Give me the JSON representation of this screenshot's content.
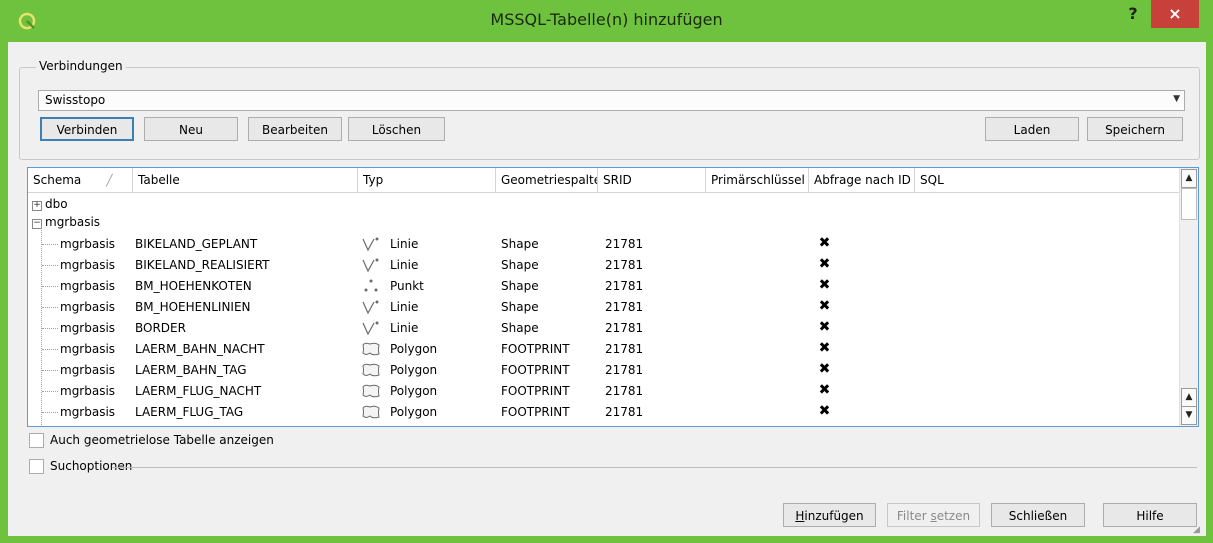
{
  "window": {
    "title": "MSSQL-Tabelle(n) hinzufügen",
    "help": "?",
    "close": "×"
  },
  "connections": {
    "legend": "Verbindungen",
    "selected": "Swisstopo",
    "buttons": {
      "connect": "Verbinden",
      "new": "Neu",
      "edit": "Bearbeiten",
      "delete": "Löschen",
      "load": "Laden",
      "save": "Speichern"
    }
  },
  "table": {
    "columns": [
      "Schema",
      "Tabelle",
      "Typ",
      "Geometriespalte",
      "SRID",
      "Primärschlüssel",
      "Abfrage nach ID",
      "SQL"
    ],
    "groups": [
      {
        "expander": "+",
        "name": "dbo"
      },
      {
        "expander": "−",
        "name": "mgrbasis"
      }
    ],
    "rows": [
      {
        "schema": "mgrbasis",
        "table": "BIKELAND_GEPLANT",
        "type": "Linie",
        "type_icon": "line-icon",
        "geom": "Shape",
        "srid": "21781",
        "select_id": true
      },
      {
        "schema": "mgrbasis",
        "table": "BIKELAND_REALISIERT",
        "type": "Linie",
        "type_icon": "line-icon",
        "geom": "Shape",
        "srid": "21781",
        "select_id": true
      },
      {
        "schema": "mgrbasis",
        "table": "BM_HOEHENKOTEN",
        "type": "Punkt",
        "type_icon": "point-icon",
        "geom": "Shape",
        "srid": "21781",
        "select_id": true
      },
      {
        "schema": "mgrbasis",
        "table": "BM_HOEHENLINIEN",
        "type": "Linie",
        "type_icon": "line-icon",
        "geom": "Shape",
        "srid": "21781",
        "select_id": true
      },
      {
        "schema": "mgrbasis",
        "table": "BORDER",
        "type": "Linie",
        "type_icon": "line-icon",
        "geom": "Shape",
        "srid": "21781",
        "select_id": true
      },
      {
        "schema": "mgrbasis",
        "table": "LAERM_BAHN_NACHT",
        "type": "Polygon",
        "type_icon": "polygon-icon",
        "geom": "FOOTPRINT",
        "srid": "21781",
        "select_id": true
      },
      {
        "schema": "mgrbasis",
        "table": "LAERM_BAHN_TAG",
        "type": "Polygon",
        "type_icon": "polygon-icon",
        "geom": "FOOTPRINT",
        "srid": "21781",
        "select_id": true
      },
      {
        "schema": "mgrbasis",
        "table": "LAERM_FLUG_NACHT",
        "type": "Polygon",
        "type_icon": "polygon-icon",
        "geom": "FOOTPRINT",
        "srid": "21781",
        "select_id": true
      },
      {
        "schema": "mgrbasis",
        "table": "LAERM_FLUG_TAG",
        "type": "Polygon",
        "type_icon": "polygon-icon",
        "geom": "FOOTPRINT",
        "srid": "21781",
        "select_id": true
      }
    ],
    "checked_mark": "✖"
  },
  "options": {
    "show_geometryless": "Auch geometrielose Tabelle anzeigen",
    "search_options": "Suchoptionen"
  },
  "footer": {
    "add_pre": "",
    "add_ul": "H",
    "add_post": "inzufügen",
    "filter_pre": "Filter ",
    "filter_ul": "s",
    "filter_post": "etzen",
    "close": "Schließen",
    "help": "Hilfe"
  },
  "colors": {
    "titlebar": "#6fc23e",
    "close": "#c7403a",
    "selection": "#5b9bd5"
  }
}
